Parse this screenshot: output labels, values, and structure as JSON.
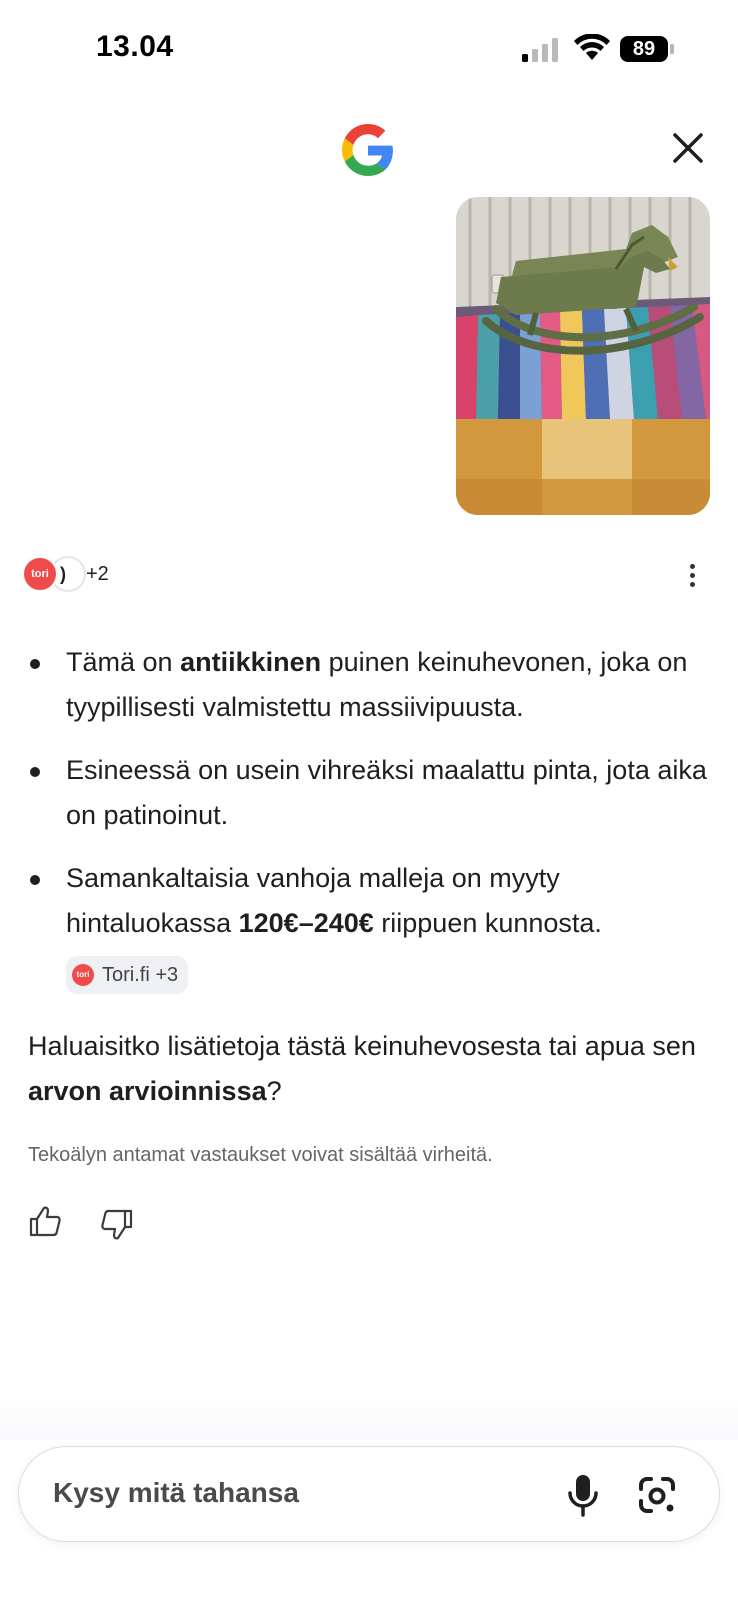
{
  "status_bar": {
    "time": "13.04",
    "battery": "89"
  },
  "header": {
    "logo": "google-g-icon",
    "close": "close-icon"
  },
  "sources": {
    "primary_logo_text": "tori",
    "secondary_logo_text": ")",
    "more_count": "+2"
  },
  "answer": {
    "bullets": [
      {
        "pre": "Tämä on ",
        "bold": "antiikkinen",
        "post": " puinen keinuhevonen, joka on tyypillisesti valmistettu massiivipuusta."
      },
      {
        "pre": "Esineessä on usein vihreäksi maalattu pinta, jota aika on patinoinut.",
        "bold": "",
        "post": ""
      },
      {
        "pre": "Samankaltaisia vanhoja malleja on myyty hintaluokassa ",
        "bold": "120€–240€",
        "post": " riippuen kunnosta.",
        "chip": {
          "logo_text": "tori",
          "label": "Tori.fi +3"
        }
      }
    ],
    "question": {
      "pre": "Haluaisitko lisätietoja tästä keinuhevosesta tai apua sen ",
      "bold": "arvon arvioinnissa",
      "post": "?"
    },
    "disclaimer": "Tekoälyn antamat vastaukset voivat sisältää virheitä."
  },
  "feedback": {
    "up": "thumbs-up-icon",
    "down": "thumbs-down-icon"
  },
  "search": {
    "placeholder": "Kysy mitä tahansa",
    "mic": "microphone-icon",
    "lens": "lens-camera-icon"
  },
  "colors": {
    "tori_red": "#ef4b4b",
    "chip_bg": "#eef0f3"
  }
}
